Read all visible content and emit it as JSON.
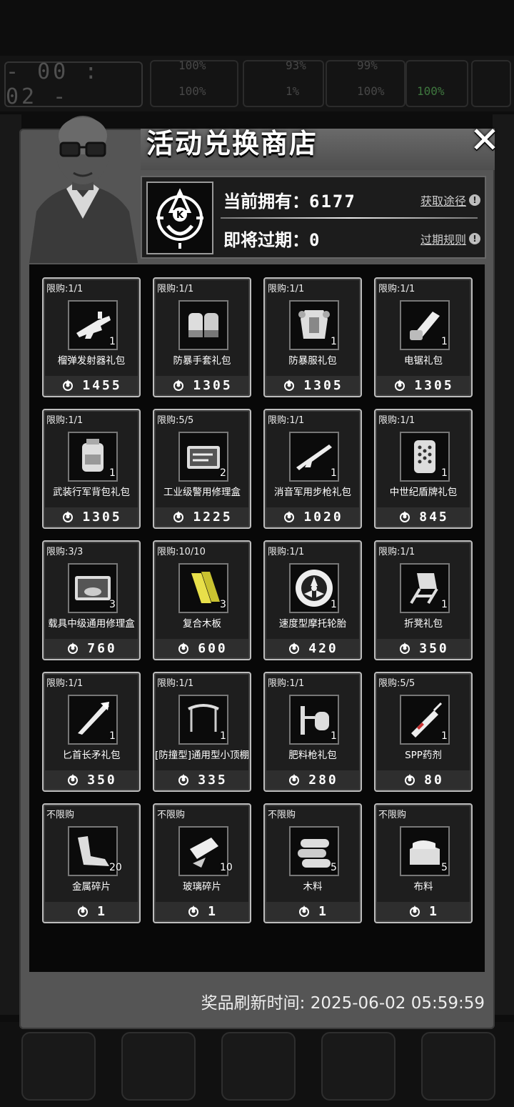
{
  "hud": {
    "timer": "- 00 : 02 -",
    "stats": [
      "100%",
      "100%",
      "93%",
      "1%",
      "99%",
      "100%",
      "100%"
    ]
  },
  "shop": {
    "title": "活动兑换商店",
    "current_label": "当前拥有：",
    "current_value": "6177",
    "expiring_label": "即将过期：",
    "expiring_value": "0",
    "obtain_link": "获取途径",
    "expire_rule_link": "过期规则",
    "refresh_label": "奖品刷新时间:",
    "refresh_time": "2025-06-02 05:59:59"
  },
  "items": [
    {
      "limit": "限购:1/1",
      "name": "榴弹发射器礼包",
      "qty": "1",
      "price": "1455",
      "icon": "grenade-launcher-icon"
    },
    {
      "limit": "限购:1/1",
      "name": "防暴手套礼包",
      "qty": "",
      "price": "1305",
      "icon": "riot-gloves-icon"
    },
    {
      "limit": "限购:1/1",
      "name": "防暴服礼包",
      "qty": "1",
      "price": "1305",
      "icon": "riot-suit-icon"
    },
    {
      "limit": "限购:1/1",
      "name": "电锯礼包",
      "qty": "1",
      "price": "1305",
      "icon": "chainsaw-icon"
    },
    {
      "limit": "限购:1/1",
      "name": "武装行军背包礼包",
      "qty": "1",
      "price": "1305",
      "icon": "backpack-icon"
    },
    {
      "limit": "限购:5/5",
      "name": "工业级警用修理盒",
      "qty": "2",
      "price": "1225",
      "icon": "repair-kit-icon"
    },
    {
      "limit": "限购:1/1",
      "name": "消音军用步枪礼包",
      "qty": "1",
      "price": "1020",
      "icon": "rifle-icon"
    },
    {
      "limit": "限购:1/1",
      "name": "中世纪盾牌礼包",
      "qty": "1",
      "price": "845",
      "icon": "shield-icon"
    },
    {
      "limit": "限购:3/3",
      "name": "载具中级通用修理盒",
      "qty": "3",
      "price": "760",
      "icon": "vehicle-repair-kit-icon"
    },
    {
      "limit": "限购:10/10",
      "name": "复合木板",
      "qty": "3",
      "price": "600",
      "icon": "plank-icon"
    },
    {
      "limit": "限购:1/1",
      "name": "速度型摩托轮胎",
      "qty": "1",
      "price": "420",
      "icon": "tire-icon"
    },
    {
      "limit": "限购:1/1",
      "name": "折凳礼包",
      "qty": "1",
      "price": "350",
      "icon": "folding-chair-icon"
    },
    {
      "limit": "限购:1/1",
      "name": "匕首长矛礼包",
      "qty": "1",
      "price": "350",
      "icon": "dagger-spear-icon"
    },
    {
      "limit": "限购:1/1",
      "name": "[防撞型]通用型小顶棚",
      "qty": "1",
      "price": "335",
      "icon": "canopy-icon"
    },
    {
      "limit": "限购:1/1",
      "name": "肥料枪礼包",
      "qty": "1",
      "price": "280",
      "icon": "fertilizer-gun-icon"
    },
    {
      "limit": "限购:5/5",
      "name": "SPP药剂",
      "qty": "1",
      "price": "80",
      "icon": "syringe-icon"
    },
    {
      "limit": "不限购",
      "name": "金属碎片",
      "qty": "20",
      "price": "1",
      "icon": "metal-scrap-icon"
    },
    {
      "limit": "不限购",
      "name": "玻璃碎片",
      "qty": "10",
      "price": "1",
      "icon": "glass-shard-icon"
    },
    {
      "limit": "不限购",
      "name": "木料",
      "qty": "5",
      "price": "1",
      "icon": "wood-logs-icon"
    },
    {
      "limit": "不限购",
      "name": "布料",
      "qty": "5",
      "price": "1",
      "icon": "cloth-icon"
    }
  ]
}
